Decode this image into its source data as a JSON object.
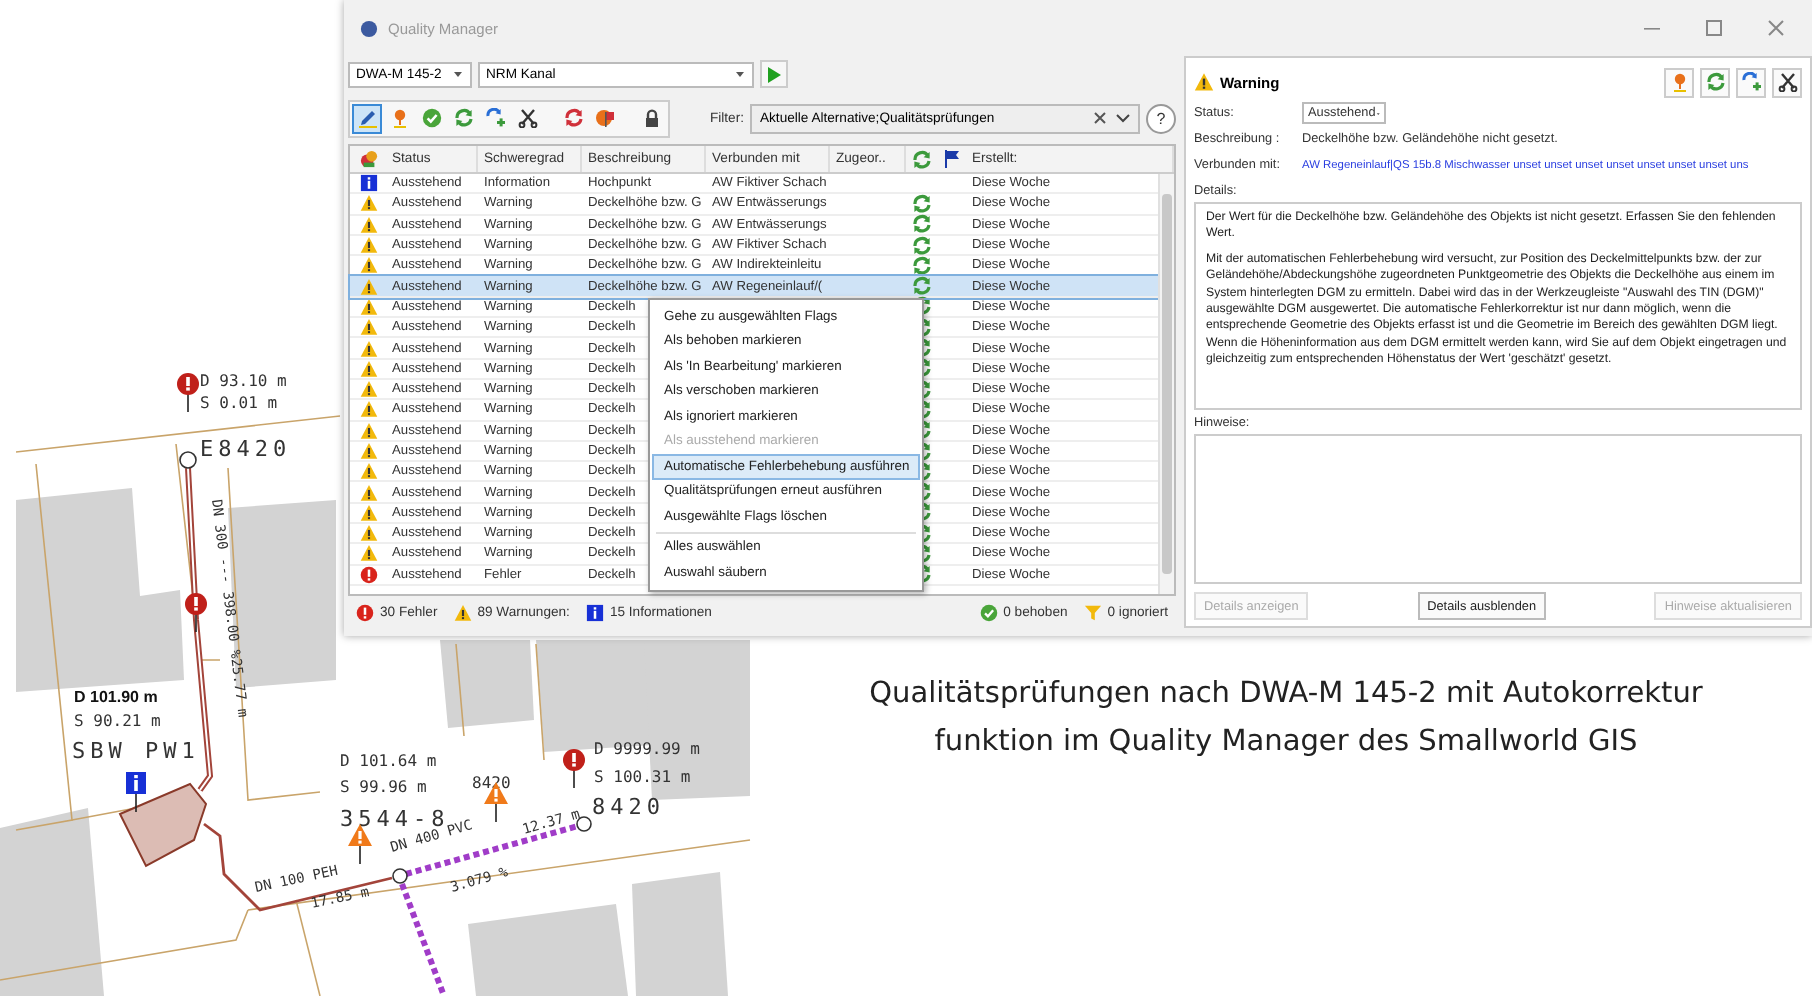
{
  "window": {
    "title": "Quality Manager"
  },
  "list_pane": {
    "selectors": [
      {
        "value": "DWA-M 145-2"
      },
      {
        "value": "NRM Kanal"
      }
    ],
    "toolbar": {
      "tools": [
        {
          "kind": "pencil",
          "selected": true
        },
        {
          "kind": "pin",
          "selected": false
        },
        {
          "kind": "check",
          "selected": false
        },
        {
          "kind": "fix",
          "selected": false
        },
        {
          "kind": "fix-blue",
          "selected": false
        },
        {
          "kind": "cut",
          "selected": false
        },
        {
          "kind": "fix-red",
          "selected": false
        },
        {
          "kind": "flag-red",
          "selected": false
        },
        {
          "kind": "lock",
          "selected": false
        }
      ],
      "filter_label": "Filter:",
      "filter_value": "Aktuelle Alternative;Qualitätsprüfungen",
      "help": "?"
    },
    "table": {
      "columns": [
        "Status",
        "Schweregrad",
        "Beschreibung",
        "Verbunden mit",
        "Zugeor..",
        "Erstellt:"
      ],
      "rows": [
        {
          "kind": "info",
          "status": "Ausstehend",
          "severity": "Information",
          "description": "Hochpunkt",
          "connected": "AW Fiktiver Schach",
          "auto_fix": false,
          "created": "Diese Woche",
          "selected": false
        },
        {
          "kind": "warning",
          "status": "Ausstehend",
          "severity": "Warning",
          "description": "Deckelhöhe bzw. G",
          "connected": "AW Entwässerungs",
          "auto_fix": true,
          "created": "Diese Woche",
          "selected": false
        },
        {
          "kind": "warning",
          "status": "Ausstehend",
          "severity": "Warning",
          "description": "Deckelhöhe bzw. G",
          "connected": "AW Entwässerungs",
          "auto_fix": true,
          "created": "Diese Woche",
          "selected": false
        },
        {
          "kind": "warning",
          "status": "Ausstehend",
          "severity": "Warning",
          "description": "Deckelhöhe bzw. G",
          "connected": "AW Fiktiver Schach",
          "auto_fix": true,
          "created": "Diese Woche",
          "selected": false
        },
        {
          "kind": "warning",
          "status": "Ausstehend",
          "severity": "Warning",
          "description": "Deckelhöhe bzw. G",
          "connected": "AW Indirekteinleitu",
          "auto_fix": true,
          "created": "Diese Woche",
          "selected": false
        },
        {
          "kind": "warning",
          "status": "Ausstehend",
          "severity": "Warning",
          "description": "Deckelhöhe bzw. G",
          "connected": "AW Regeneinlauf/(",
          "auto_fix": true,
          "created": "Diese Woche",
          "selected": true
        },
        {
          "kind": "warning",
          "status": "Ausstehend",
          "severity": "Warning",
          "description": "Deckelh",
          "auto_fix": true,
          "created": "Diese Woche",
          "selected": false
        },
        {
          "kind": "warning",
          "status": "Ausstehend",
          "severity": "Warning",
          "description": "Deckelh",
          "auto_fix": true,
          "created": "Diese Woche",
          "selected": false
        },
        {
          "kind": "warning",
          "status": "Ausstehend",
          "severity": "Warning",
          "description": "Deckelh",
          "auto_fix": true,
          "created": "Diese Woche",
          "selected": false
        },
        {
          "kind": "warning",
          "status": "Ausstehend",
          "severity": "Warning",
          "description": "Deckelh",
          "auto_fix": true,
          "created": "Diese Woche",
          "selected": false
        },
        {
          "kind": "warning",
          "status": "Ausstehend",
          "severity": "Warning",
          "description": "Deckelh",
          "auto_fix": true,
          "created": "Diese Woche",
          "selected": false
        },
        {
          "kind": "warning",
          "status": "Ausstehend",
          "severity": "Warning",
          "description": "Deckelh",
          "auto_fix": true,
          "created": "Diese Woche",
          "selected": false
        },
        {
          "kind": "warning",
          "status": "Ausstehend",
          "severity": "Warning",
          "description": "Deckelh",
          "auto_fix": true,
          "created": "Diese Woche",
          "selected": false
        },
        {
          "kind": "warning",
          "status": "Ausstehend",
          "severity": "Warning",
          "description": "Deckelh",
          "auto_fix": true,
          "created": "Diese Woche",
          "selected": false
        },
        {
          "kind": "warning",
          "status": "Ausstehend",
          "severity": "Warning",
          "description": "Deckelh",
          "auto_fix": true,
          "created": "Diese Woche",
          "selected": false
        },
        {
          "kind": "warning",
          "status": "Ausstehend",
          "severity": "Warning",
          "description": "Deckelh",
          "auto_fix": true,
          "created": "Diese Woche",
          "selected": false
        },
        {
          "kind": "warning",
          "status": "Ausstehend",
          "severity": "Warning",
          "description": "Deckelh",
          "auto_fix": true,
          "created": "Diese Woche",
          "selected": false
        },
        {
          "kind": "warning",
          "status": "Ausstehend",
          "severity": "Warning",
          "description": "Deckelh",
          "auto_fix": true,
          "created": "Diese Woche",
          "selected": false
        },
        {
          "kind": "warning",
          "status": "Ausstehend",
          "severity": "Warning",
          "description": "Deckelh",
          "auto_fix": true,
          "created": "Diese Woche",
          "selected": false
        },
        {
          "kind": "error",
          "status": "Ausstehend",
          "severity": "Fehler",
          "description": "Deckelh",
          "auto_fix": true,
          "created": "Diese Woche",
          "selected": false
        }
      ]
    },
    "context_menu": {
      "items": [
        {
          "label": "Gehe zu ausgewählten Flags",
          "disabled": false,
          "selected": false,
          "separator_before": false
        },
        {
          "label": "Als behoben markieren",
          "disabled": false,
          "selected": false,
          "separator_before": false
        },
        {
          "label": "Als 'In Bearbeitung' markieren",
          "disabled": false,
          "selected": false,
          "separator_before": false
        },
        {
          "label": "Als verschoben markieren",
          "disabled": false,
          "selected": false,
          "separator_before": false
        },
        {
          "label": "Als ignoriert markieren",
          "disabled": false,
          "selected": false,
          "separator_before": false
        },
        {
          "label": "Als ausstehend markieren",
          "disabled": true,
          "selected": false,
          "separator_before": false
        },
        {
          "label": "Automatische Fehlerbehebung ausführen",
          "disabled": false,
          "selected": true,
          "separator_before": false
        },
        {
          "label": "Qualitätsprüfungen erneut ausführen",
          "disabled": false,
          "selected": false,
          "separator_before": false
        },
        {
          "label": "Ausgewählte Flags löschen",
          "disabled": false,
          "selected": false,
          "separator_before": false
        },
        {
          "label": "Alles auswählen",
          "disabled": false,
          "selected": false,
          "separator_before": true
        },
        {
          "label": "Auswahl säubern",
          "disabled": false,
          "selected": false,
          "separator_before": false
        }
      ]
    },
    "status_bar": {
      "left": [
        {
          "kind": "error",
          "text": "30 Fehler"
        },
        {
          "kind": "warning",
          "text": "89 Warnungen:"
        },
        {
          "kind": "info",
          "text": "15 Informationen"
        }
      ],
      "right": [
        {
          "kind": "fixed",
          "text": "0 behoben"
        },
        {
          "kind": "ignored",
          "text": "0 ignoriert"
        }
      ]
    }
  },
  "detail_pane": {
    "kind": "warning",
    "title": "Warning",
    "tools": [
      {
        "kind": "pin"
      },
      {
        "kind": "fix"
      },
      {
        "kind": "fix-blue"
      },
      {
        "kind": "cut"
      }
    ],
    "fields": [
      {
        "kind": "dropdown",
        "label": "Status:",
        "value": "Ausstehend"
      },
      {
        "kind": "text",
        "label": "Beschreibung :",
        "value": "Deckelhöhe bzw. Geländehöhe nicht gesetzt."
      },
      {
        "kind": "link",
        "label": "Verbunden mit:",
        "value": "AW Regeneinlauf|QS 15b.8 Mischwasser unset unset unset unset unset unset unset uns"
      }
    ],
    "details_label": "Details:",
    "details": [
      "Der Wert für die Deckelhöhe bzw. Geländehöhe des Objekts ist nicht gesetzt. Erfassen Sie den fehlenden Wert.",
      "Mit der automatischen Fehlerbehebung wird versucht, zur Position des Deckelmittelpunkts bzw. der zur Geländehöhe/Abdeckungshöhe zugeordneten Punktgeometrie des Objekts die Deckelhöhe aus einem im System hinterlegten DGM zu ermitteln. Dabei wird das in der Werkzeugleiste \"Auswahl des TIN (DGM)\" ausgewählte DGM ausgewertet. Die automatische Fehlerkorrektur ist nur dann möglich, wenn die entsprechende Geometrie des Objekts erfasst ist und die Geometrie im Bereich des gewählten DGM liegt. Wenn die Höheninformation aus dem DGM ermittelt werden kann, wird Sie auf dem Objekt eingetragen und gleichzeitig zum entsprechenden Höhenstatus der Wert 'geschätzt' gesetzt."
    ],
    "notes_label": "Hinweise:",
    "buttons": [
      {
        "label": "Details anzeigen",
        "disabled": true
      },
      {
        "label": "Details ausblenden",
        "disabled": false
      },
      {
        "label": "Hinweise aktualisieren",
        "disabled": true
      }
    ]
  },
  "map": {
    "labels": [
      {
        "kind": "value",
        "text": "D 93.10 m"
      },
      {
        "kind": "value",
        "text": "S  0.01 m"
      },
      {
        "kind": "name",
        "text": "E8420"
      },
      {
        "kind": "pipe",
        "text": "DN 300 --- 398.00 %25.77 m"
      },
      {
        "kind": "bold",
        "text": "D 101.90 m"
      },
      {
        "kind": "value",
        "text": "S 90.21 m"
      },
      {
        "kind": "name",
        "text": "SBW PW1"
      },
      {
        "kind": "value",
        "text": "D 101.64 m"
      },
      {
        "kind": "value",
        "text": "S 99.96 m"
      },
      {
        "kind": "name",
        "text": "3544-8"
      },
      {
        "kind": "value",
        "text": "8420"
      },
      {
        "kind": "pipe",
        "text": "DN 400 PVC"
      },
      {
        "kind": "pipe",
        "text": "12.37 m"
      },
      {
        "kind": "pipe",
        "text": "3.079 %"
      },
      {
        "kind": "pipe",
        "text": "DN 100 PEH"
      },
      {
        "kind": "pipe",
        "text": "17.85 m"
      },
      {
        "kind": "value",
        "text": "D 9999.99 m"
      },
      {
        "kind": "value",
        "text": "S 100.31 m"
      },
      {
        "kind": "name",
        "text": "8420"
      }
    ],
    "markers": [
      {
        "kind": "error"
      },
      {
        "kind": "error"
      },
      {
        "kind": "info"
      },
      {
        "kind": "warning"
      },
      {
        "kind": "warning"
      },
      {
        "kind": "error"
      }
    ]
  },
  "caption": {
    "lines": [
      "Qualitätsprüfungen nach DWA-M 145-2 mit Autokorrektur",
      "funktion im Quality Manager des Smallworld GIS"
    ]
  }
}
